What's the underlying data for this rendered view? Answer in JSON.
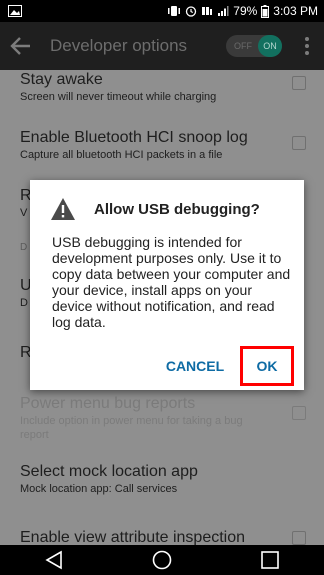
{
  "status_bar": {
    "battery_percent": "79%",
    "time": "3:03 PM"
  },
  "action_bar": {
    "title": "Developer options",
    "toggle_off_label": "OFF",
    "toggle_on_label": "ON"
  },
  "settings": [
    {
      "title": "Stay awake",
      "subtitle": "Screen will never timeout while charging",
      "checked": false
    },
    {
      "title": "Enable Bluetooth HCI snoop log",
      "subtitle": "Capture all bluetooth HCI packets in a file",
      "checked": false
    },
    {
      "title": "R",
      "subtitle": "V"
    },
    {
      "section": "D"
    },
    {
      "title": "U",
      "subtitle": "D"
    },
    {
      "title": "R"
    },
    {
      "title": "Power menu bug reports",
      "subtitle": "Include option in power menu for taking a bug report",
      "disabled": true,
      "checked": false
    },
    {
      "title": "Select mock location app",
      "subtitle": "Mock location app: Call services"
    },
    {
      "title": "Enable view attribute inspection",
      "checked": false
    }
  ],
  "dialog": {
    "title": "Allow USB debugging?",
    "message": "USB debugging is intended for development purposes only. Use it to copy data between your computer and your device, install apps on your device without notification, and read log data.",
    "cancel_label": "CANCEL",
    "ok_label": "OK"
  },
  "colors": {
    "accent": "#0e6ba4",
    "toggle_on": "#12705f",
    "highlight": "#ff0000"
  }
}
